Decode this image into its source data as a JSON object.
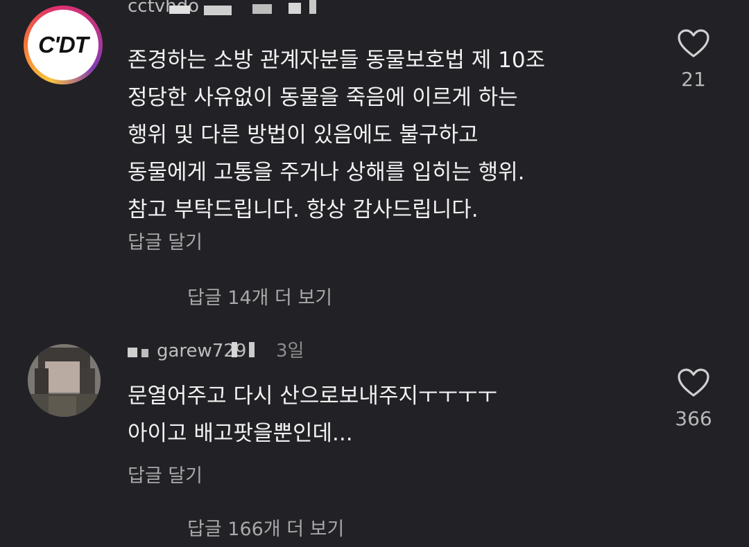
{
  "comments": [
    {
      "username": "cctvhdo",
      "avatar_logo": "C'DT",
      "lines": [
        "존경하는 소방 관계자분들 동물보호법 제 10조",
        "정당한 사유없이 동물을 죽음에 이르게 하는",
        "행위 및 다른 방법이 있음에도 불구하고",
        "동물에게 고통을 주거나 상해를 입히는 행위.",
        "참고 부탁드립니다. 항상 감사드립니다."
      ],
      "reply_label": "답글 달기",
      "like_count": "21",
      "more_replies": "답글 14개 더 보기"
    },
    {
      "username": "garew729",
      "timestamp": "3일",
      "lines": [
        "문열어주고 다시 산으로보내주지ㅜㅜㅜㅜ",
        "아이고 배고팟을뿐인데..."
      ],
      "reply_label": "답글 달기",
      "like_count": "366",
      "more_replies": "답글 166개 더 보기"
    }
  ],
  "icons": {
    "like": "heart-outline-icon"
  },
  "colors": {
    "background": "#222125",
    "text_primary": "#f2f2f2",
    "text_secondary": "#a8a8a8"
  }
}
